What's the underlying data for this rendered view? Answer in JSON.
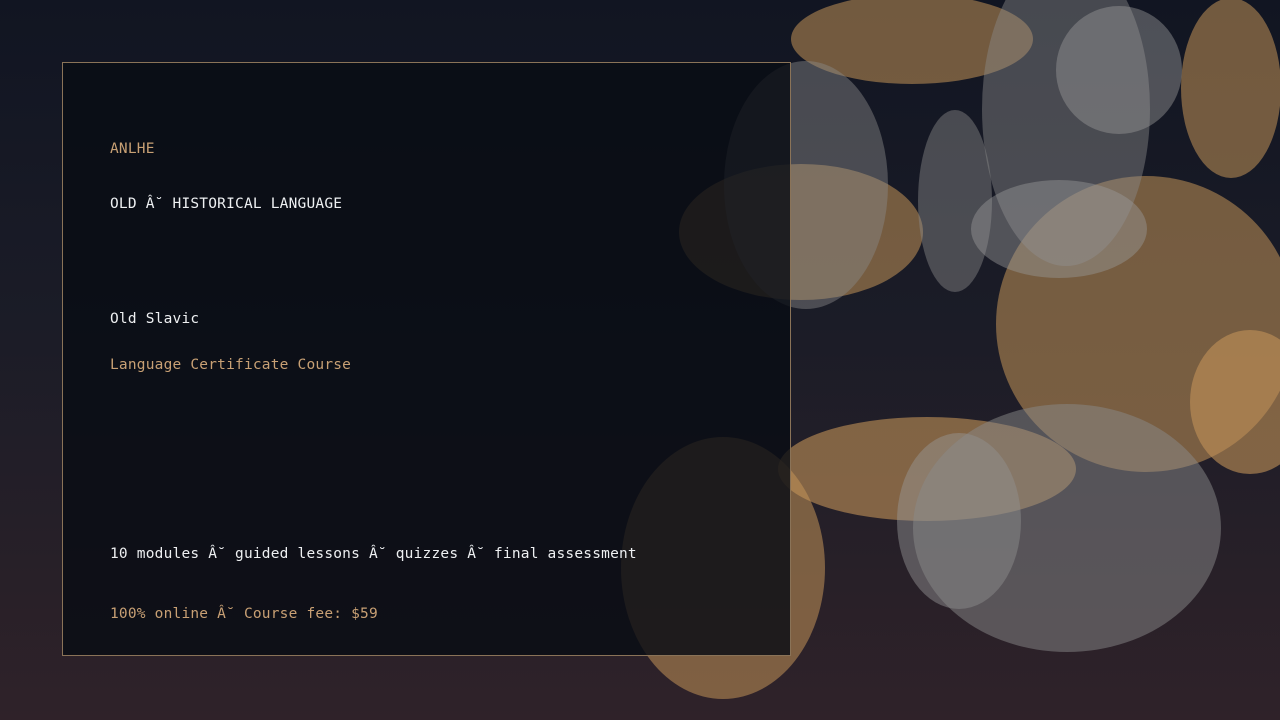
{
  "brand": "ANLHE",
  "category": "OLD Â˘ HISTORICAL LANGUAGE",
  "course_title": "Old Slavic",
  "course_subtitle": "Language Certificate Course",
  "course_details": "10 modules Â˘ guided lessons Â˘ quizzes Â˘ final assessment",
  "course_price_line": "100% online Â˘ Course fee: $59",
  "colors": {
    "accent": "#c8a074",
    "text": "#eef0f2",
    "card_border": "#8a7358",
    "bokeh_gold": "#c39358",
    "bokeh_grey": "#8a8a8a"
  }
}
